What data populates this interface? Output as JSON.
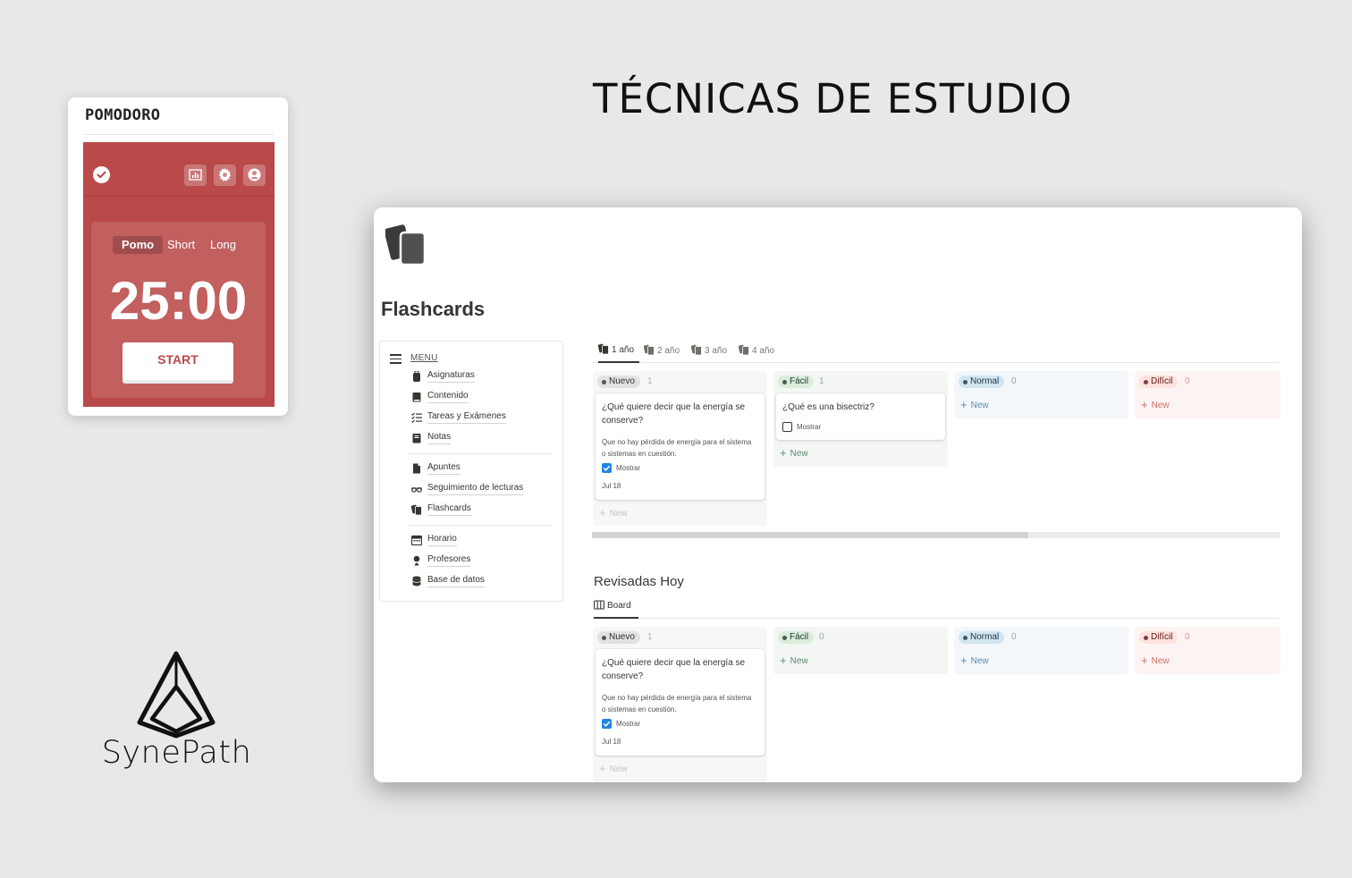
{
  "pomodoro": {
    "title": "POMODORO",
    "modes": [
      "Pomo",
      "Short",
      "Long"
    ],
    "active_mode": "Pomo",
    "time": "25:00",
    "start_label": "START",
    "accent": "#ba4949",
    "icons": [
      "check-circle-icon",
      "chart-icon",
      "gear-icon",
      "user-icon"
    ]
  },
  "heading": "TÉCNICAS DE ESTUDIO",
  "logo": {
    "text": "SynePath",
    "icon": "pyramid-logo-icon"
  },
  "notion": {
    "page_icon": "flashcards-icon",
    "page_title": "Flashcards",
    "menu": {
      "title": "MENU",
      "groups": [
        [
          {
            "label": "Asignaturas",
            "icon": "backpack-icon"
          },
          {
            "label": "Contenido",
            "icon": "book-icon"
          },
          {
            "label": "Tareas y Exámenes",
            "icon": "checklist-icon"
          },
          {
            "label": "Notas",
            "icon": "notebook-icon"
          }
        ],
        [
          {
            "label": "Apuntes",
            "icon": "document-icon"
          },
          {
            "label": "Seguimiento de lecturas",
            "icon": "glasses-icon"
          },
          {
            "label": "Flashcards",
            "icon": "flashcards-icon"
          }
        ],
        [
          {
            "label": "Horario",
            "icon": "calendar-icon"
          },
          {
            "label": "Profesores",
            "icon": "person-icon"
          },
          {
            "label": "Base de datos",
            "icon": "database-icon"
          }
        ]
      ]
    },
    "tabs": [
      "1 año",
      "2 año",
      "3 año",
      "4 año"
    ],
    "active_tab": "1 año",
    "new_label": "New",
    "board1": {
      "columns": [
        {
          "name": "Nuevo",
          "count": "1",
          "color": "#787774",
          "cards": [
            {
              "question": "¿Qué quiere decir que la energía se conserve?",
              "answer": "Que no hay pérdida de energía para el sistema o sistemas en cuestión.",
              "check_label": "Mostrar",
              "checked": true,
              "date": "Jul 18"
            }
          ]
        },
        {
          "name": "Fácil",
          "count": "1",
          "color": "#448361",
          "cards": [
            {
              "question": "¿Qué es una bisectriz?",
              "check_label": "Mostrar",
              "checked": false
            }
          ]
        },
        {
          "name": "Normal",
          "count": "0",
          "color": "#337ea9",
          "cards": []
        },
        {
          "name": "Difícil",
          "count": "0",
          "color": "#d44c47",
          "cards": []
        }
      ]
    },
    "section2_title": "Revisadas Hoy",
    "board2_tab": "Board",
    "board2": {
      "columns": [
        {
          "name": "Nuevo",
          "count": "1",
          "cards": [
            {
              "question": "¿Qué quiere decir que la energía se conserve?",
              "answer": "Que no hay pérdida de energía para el sistema o sistemas en cuestión.",
              "check_label": "Mostrar",
              "checked": true,
              "date": "Jul 18"
            }
          ]
        },
        {
          "name": "Fácil",
          "count": "0",
          "cards": []
        },
        {
          "name": "Normal",
          "count": "0",
          "cards": []
        },
        {
          "name": "Difícil",
          "count": "0",
          "cards": []
        }
      ]
    }
  }
}
